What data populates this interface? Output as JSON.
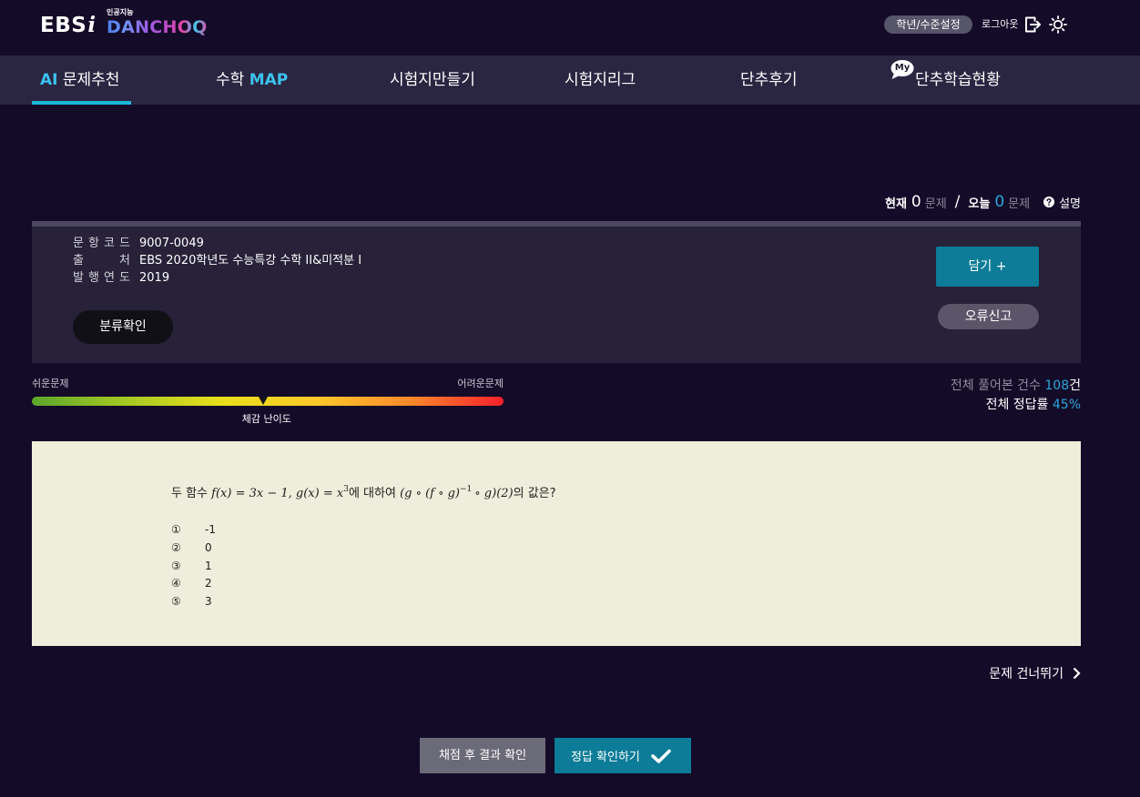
{
  "header": {
    "logo": {
      "ebs": "EBS",
      "i": "i",
      "tagline": "인공지능",
      "brand": "DANCHOQ"
    },
    "grade_setting": "학년/수준설정",
    "logout": "로그아웃",
    "icons": {
      "logout": "logout-icon",
      "theme": "sun-icon"
    }
  },
  "nav": {
    "ai_recommend": {
      "highlight": "AI",
      "label": "문제추천"
    },
    "math_map": {
      "label": "수학",
      "highlight": "MAP"
    },
    "exam_maker": "시험지만들기",
    "exam_league": "시험지리그",
    "reviews": "단추후기",
    "learning_status": {
      "badge": "My",
      "label": "단추학습현황"
    }
  },
  "progress": {
    "current_label": "현재",
    "current_count": "0",
    "current_unit": "문제",
    "separator": "/",
    "today_label": "오늘",
    "today_count": "0",
    "today_unit": "문제",
    "help_icon": "help-circle-icon",
    "help_label": "설명"
  },
  "item_info": {
    "code": {
      "label": "문 항 코 드",
      "value": "9007-0049"
    },
    "source": {
      "label": "출 처",
      "value": "EBS 2020학년도 수능특강 수학 II&미적분 I"
    },
    "year": {
      "label": "발 행 연 도",
      "value": "2019"
    },
    "classify_button": "분류확인",
    "add_button": "담기 +",
    "report_button": "오류신고"
  },
  "difficulty": {
    "easy_label": "쉬운문제",
    "hard_label": "어려운문제",
    "caption": "체감 난이도",
    "level": 0.49,
    "scale_colors": [
      "#5ca62b",
      "#a6c923",
      "#e8df1b",
      "#fbc92a",
      "#fb8a2b",
      "#f5202c"
    ]
  },
  "stats": {
    "solved_label": "전체 풀어본 건수",
    "solved_count": "108",
    "solved_unit": "건",
    "accuracy_label": "전체 정답률",
    "accuracy_value": "45%"
  },
  "question": {
    "lead": "두 함수",
    "f_def": "f(x) = 3x − 1,",
    "g_def": "g(x) = x",
    "g_exp": "3",
    "connector": "에 대하여",
    "comp_open": "(g ∘ (f ∘ g)",
    "comp_exp": "−1",
    "comp_close": "∘ g)(2)",
    "tail": "의 값은?",
    "options": [
      {
        "marker": "①",
        "value": "-1"
      },
      {
        "marker": "②",
        "value": "0"
      },
      {
        "marker": "③",
        "value": "1"
      },
      {
        "marker": "④",
        "value": "2"
      },
      {
        "marker": "⑤",
        "value": "3"
      }
    ]
  },
  "skip": {
    "label": "문제 건너뛰기",
    "icon": "chevron-right-icon"
  },
  "actions": {
    "grade_button": "채점 후 결과 확인",
    "answer_button": "정답 확인하기",
    "answer_icon": "checkmark-icon"
  },
  "colors": {
    "page_bg": "#130b28",
    "nav_bg": "#2a2541",
    "panel_bg": "#272139",
    "accent": "#3cc2ee",
    "count_accent": "#2aa7d8",
    "primary_button": "#0c7c98",
    "question_bg": "#efeedc"
  }
}
